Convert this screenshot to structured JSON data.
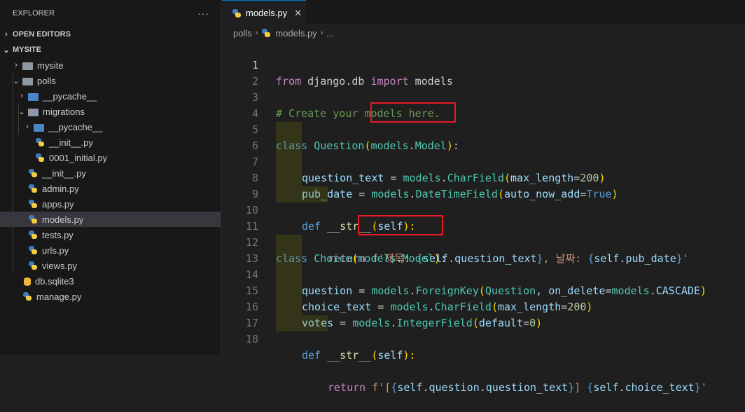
{
  "sidebar": {
    "title": "EXPLORER",
    "more": "···",
    "open_editors": "OPEN EDITORS",
    "project": "MYSITE",
    "items": [
      {
        "label": "mysite"
      },
      {
        "label": "polls"
      },
      {
        "label": "__pycache__"
      },
      {
        "label": "migrations"
      },
      {
        "label": "__pycache__"
      },
      {
        "label": "__init__.py"
      },
      {
        "label": "0001_initial.py"
      },
      {
        "label": "__init__.py"
      },
      {
        "label": "admin.py"
      },
      {
        "label": "apps.py"
      },
      {
        "label": "models.py"
      },
      {
        "label": "tests.py"
      },
      {
        "label": "urls.py"
      },
      {
        "label": "views.py"
      },
      {
        "label": "db.sqlite3"
      },
      {
        "label": "manage.py"
      }
    ]
  },
  "tab": {
    "label": "models.py",
    "close": "✕"
  },
  "breadcrumb": {
    "folder": "polls",
    "file": "models.py",
    "more": "..."
  },
  "code": {
    "line_numbers": [
      "1",
      "2",
      "3",
      "4",
      "5",
      "6",
      "7",
      "8",
      "9",
      "10",
      "11",
      "12",
      "13",
      "14",
      "15",
      "16",
      "17",
      "18"
    ],
    "l1": [
      "from",
      " django.db ",
      "import",
      " models"
    ],
    "l3": "# Create your models here.",
    "l5": [
      "class",
      " ",
      "Question",
      "(",
      "models",
      ".",
      "Model",
      ")",
      ":"
    ],
    "l6": [
      "question_text",
      " = ",
      "models",
      ".",
      "CharField",
      "(",
      "max_length",
      "=",
      "200",
      ")"
    ],
    "l7": [
      "pub_date",
      " = ",
      "models",
      ".",
      "DateTimeField",
      "(",
      "auto_now_add",
      "=",
      "True",
      ")"
    ],
    "l9": [
      "def",
      " ",
      "__str__",
      "(",
      "self",
      "):"
    ],
    "l10": [
      "return",
      " ",
      "f'제목: ",
      "{",
      "self",
      ".",
      "question_text",
      "}",
      ", 날짜: ",
      "{",
      "self",
      ".",
      "pub_date",
      "}",
      "'"
    ],
    "l12": [
      "class",
      " ",
      "Choice",
      "(",
      "models",
      ".",
      "Model",
      ")",
      ":"
    ],
    "l13": [
      "question",
      " = ",
      "models",
      ".",
      "ForeignKey",
      "(",
      "Question",
      ", ",
      "on_delete",
      "=",
      "models",
      ".",
      "CASCADE",
      ")"
    ],
    "l14": [
      "choice_text",
      " = ",
      "models",
      ".",
      "CharField",
      "(",
      "max_length",
      "=",
      "200",
      ")"
    ],
    "l15": [
      "votes",
      " = ",
      "models",
      ".",
      "IntegerField",
      "(",
      "default",
      "=",
      "0",
      ")"
    ],
    "l17": [
      "def",
      " ",
      "__str__",
      "(",
      "self",
      "):"
    ],
    "l18": [
      "return",
      " ",
      "f'[",
      "{",
      "self",
      ".",
      "question",
      ".",
      "question_text",
      "}",
      "] ",
      "{",
      "self",
      ".",
      "choice_text",
      "}",
      "'"
    ]
  },
  "colors": {
    "highlight_box": "#e51b24",
    "accent": "#0078d4"
  }
}
